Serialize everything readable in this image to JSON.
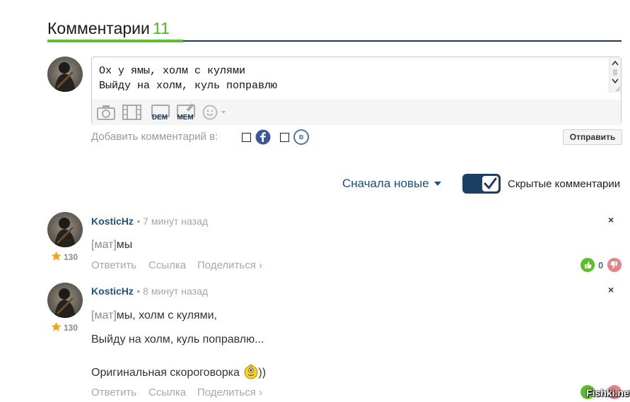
{
  "header": {
    "title": "Комментарии",
    "count": "11"
  },
  "compose": {
    "text_line1": "Ох у ямы, холм с кулями",
    "text_line2": "Выйду на холм, куль поправлю",
    "tools": [
      "camera-icon",
      "film-icon",
      "dem-icon",
      "mem-icon",
      "smiley-icon"
    ],
    "dem_label": "DEM",
    "mem_label": "MEM",
    "add_label": "Добавить комментарий в:",
    "vk_label": "в",
    "send_label": "Отправить"
  },
  "controls": {
    "sort_label": "Сначала новые",
    "hidden_label": "Скрытые комментарии",
    "hidden_enabled": true
  },
  "comments": [
    {
      "author": "KosticHz",
      "time": "• 7 минут назад",
      "rating": "130",
      "mat": "[мат]",
      "text1": "мы",
      "reply": "Ответить",
      "link": "Ссылка",
      "share": "Поделиться ›",
      "votes": "0",
      "close": "×"
    },
    {
      "author": "KosticHz",
      "time": "• 8 минут назад",
      "rating": "130",
      "mat": "[мат]",
      "text1": "мы, холм с кулями,",
      "text2": "Выйду на холм, куль поправлю...",
      "text3": "Оригинальная скороговорка",
      "text3_tail": "))",
      "reply": "Ответить",
      "link": "Ссылка",
      "share": "Поделиться ›",
      "close": "×"
    }
  ],
  "colors": {
    "accent_green": "#62be2c",
    "count_green": "#52b21f",
    "navy": "#1c3a56",
    "link_blue": "#22527c"
  },
  "watermark": "Fishki.net"
}
